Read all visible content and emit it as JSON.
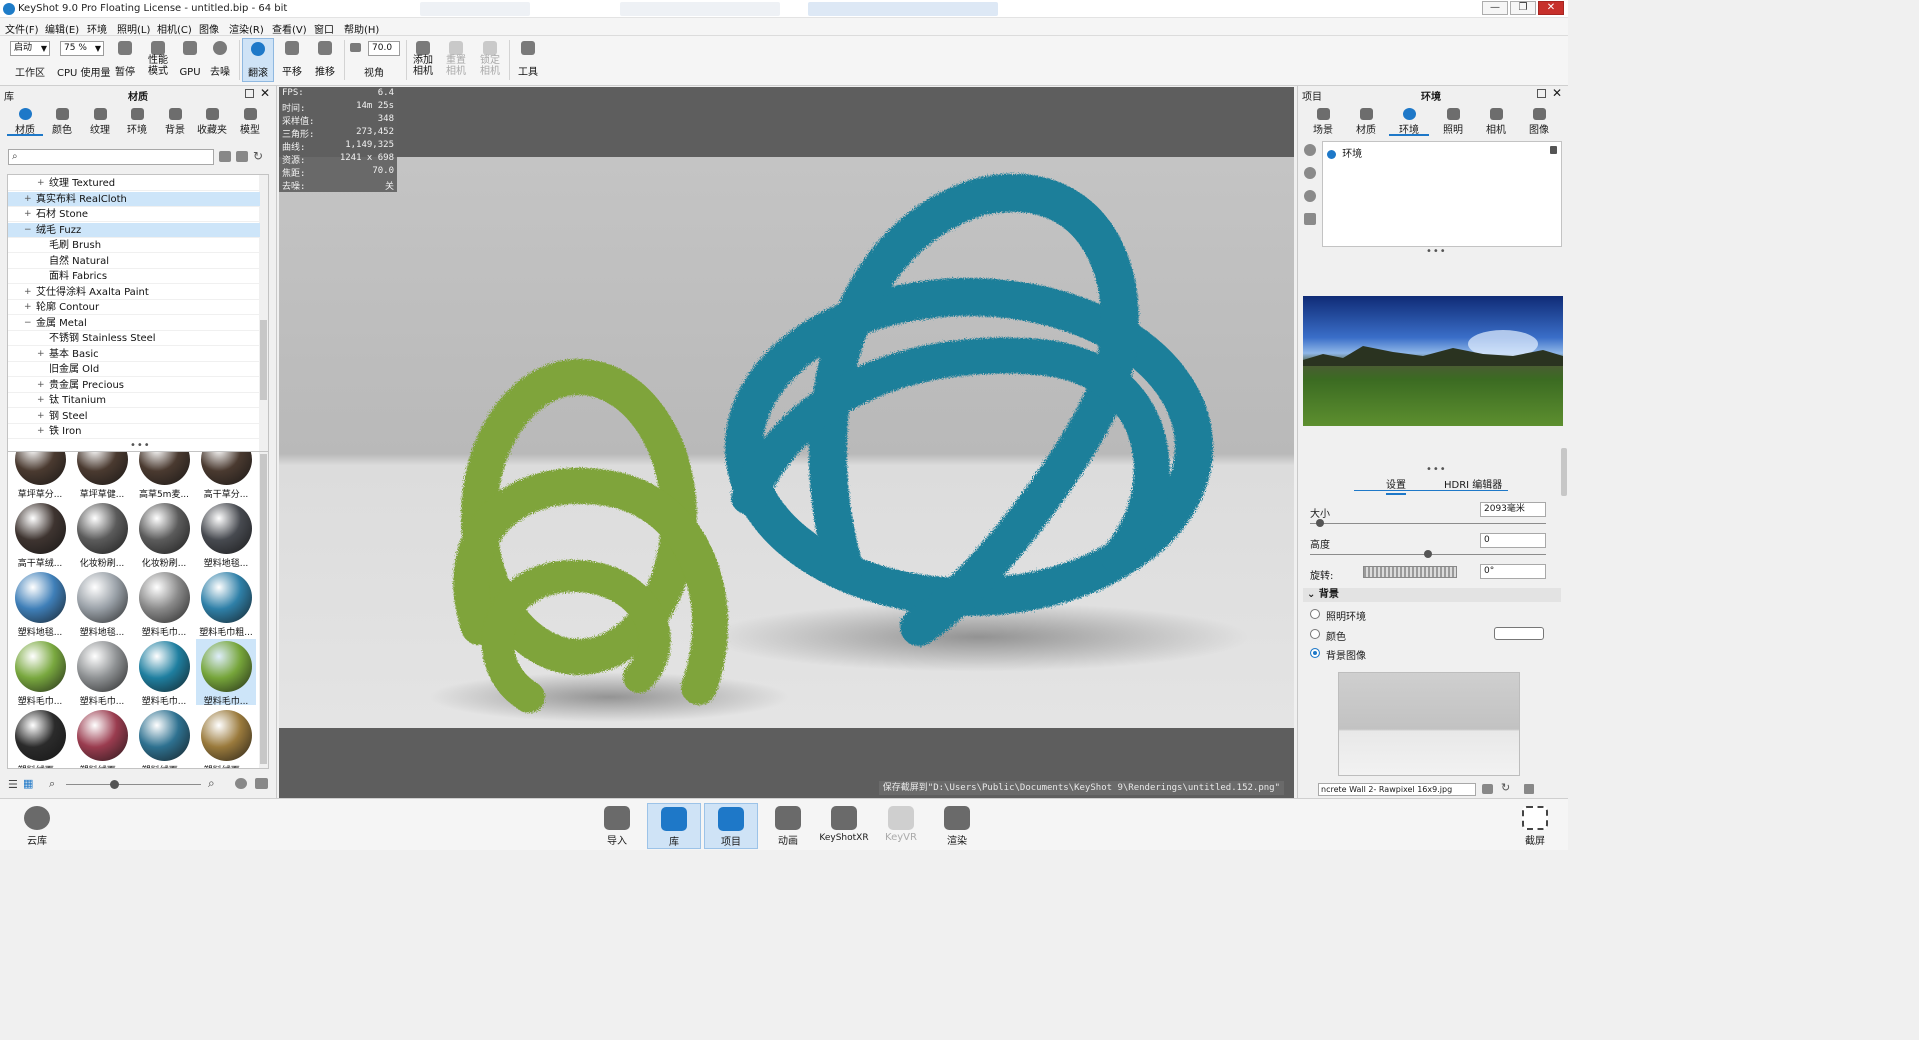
{
  "window": {
    "title": "KeyShot 9.0 Pro Floating License  - untitled.bip  - 64 bit",
    "controls": {
      "minimize": "—",
      "restore": "❐",
      "close": "✕"
    }
  },
  "menu": [
    "文件(F)",
    "编辑(E)",
    "环境",
    "照明(L)",
    "相机(C)",
    "图像",
    "渲染(R)",
    "查看(V)",
    "窗口",
    "帮助(H)"
  ],
  "toolbar": {
    "startup_value": "启动",
    "workspace_label": "工作区",
    "cpu_value": "75 %",
    "cpu_label": "CPU 使用量",
    "pause_label": "暂停",
    "performance_label": "性能\n模式",
    "gpu_label": "GPU",
    "denoise_label": "去噪",
    "tumble_label": "翻滚",
    "pan_label": "平移",
    "dolly_label": "推移",
    "fov_value": "70.0",
    "fov_label": "视角",
    "add_camera_label": "添加\n相机",
    "reset_camera_label": "重置\n相机",
    "lock_camera_label": "锁定\n相机",
    "tools_label": "工具"
  },
  "library": {
    "header_left": "库",
    "header_title": "材质",
    "tabs": [
      "材质",
      "颜色",
      "纹理",
      "环境",
      "背景",
      "收藏夹",
      "模型"
    ],
    "search_placeholder": "",
    "tree": [
      {
        "label": "纹理 Textured",
        "level": 1,
        "expander": "+",
        "selected": false
      },
      {
        "label": "真实布料 RealCloth",
        "level": 0,
        "expander": "+",
        "selected": true
      },
      {
        "label": "石材 Stone",
        "level": 0,
        "expander": "+",
        "selected": false
      },
      {
        "label": "绒毛 Fuzz",
        "level": 0,
        "expander": "−",
        "selected": true
      },
      {
        "label": "毛刷 Brush",
        "level": 1,
        "expander": "",
        "selected": false
      },
      {
        "label": "自然 Natural",
        "level": 1,
        "expander": "",
        "selected": false
      },
      {
        "label": "面料 Fabrics",
        "level": 1,
        "expander": "",
        "selected": false
      },
      {
        "label": "艾仕得涂料 Axalta Paint",
        "level": 0,
        "expander": "+",
        "selected": false
      },
      {
        "label": "轮廓 Contour",
        "level": 0,
        "expander": "+",
        "selected": false
      },
      {
        "label": "金属 Metal",
        "level": 0,
        "expander": "−",
        "selected": false
      },
      {
        "label": "不锈钢 Stainless Steel",
        "level": 1,
        "expander": "",
        "selected": false
      },
      {
        "label": "基本 Basic",
        "level": 1,
        "expander": "+",
        "selected": false
      },
      {
        "label": "旧金属 Old",
        "level": 1,
        "expander": "",
        "selected": false
      },
      {
        "label": "贵金属 Precious",
        "level": 1,
        "expander": "+",
        "selected": false
      },
      {
        "label": "钛 Titanium",
        "level": 1,
        "expander": "+",
        "selected": false
      },
      {
        "label": "钢 Steel",
        "level": 1,
        "expander": "+",
        "selected": false
      },
      {
        "label": "铁 Iron",
        "level": 1,
        "expander": "+",
        "selected": false
      }
    ],
    "materials": [
      {
        "label": "草坪草分...",
        "color": "#4a3a30",
        "selected": false
      },
      {
        "label": "草坪草健...",
        "color": "#4a3a30",
        "selected": false
      },
      {
        "label": "高草5m麦...",
        "color": "#4a3a30",
        "selected": false
      },
      {
        "label": "高干草分...",
        "color": "#4a3a30",
        "selected": false
      },
      {
        "label": "高干草绒...",
        "color": "#3e3430",
        "selected": false
      },
      {
        "label": "化妆粉刷...",
        "color": "#5b5b5b",
        "selected": false
      },
      {
        "label": "化妆粉刷...",
        "color": "#5b5b5b",
        "selected": false
      },
      {
        "label": "塑料地毯...",
        "color": "#474a50",
        "selected": false
      },
      {
        "label": "塑料地毯...",
        "color": "#3f7fb8",
        "selected": false
      },
      {
        "label": "塑料地毯...",
        "color": "#9aa1a8",
        "selected": false
      },
      {
        "label": "塑料毛巾...",
        "color": "#8a8a8a",
        "selected": false
      },
      {
        "label": "塑料毛巾粗...",
        "color": "#2f80a8",
        "selected": false
      },
      {
        "label": "塑料毛巾...",
        "color": "#79a83f",
        "selected": false
      },
      {
        "label": "塑料毛巾...",
        "color": "#8f9294",
        "selected": false
      },
      {
        "label": "塑料毛巾...",
        "color": "#1f7fa0",
        "selected": false
      },
      {
        "label": "塑料毛巾...",
        "color": "#76a53a",
        "selected": true
      },
      {
        "label": "塑料绒面...",
        "color": "#2b2b2b",
        "selected": false
      },
      {
        "label": "塑料绒面...",
        "color": "#9a3c4f",
        "selected": false
      },
      {
        "label": "塑料绒面...",
        "color": "#2e7190",
        "selected": false
      },
      {
        "label": "塑料绒面...",
        "color": "#9a7a3c",
        "selected": false
      }
    ]
  },
  "viewport": {
    "hud": [
      {
        "k": "FPS:",
        "v": "6.4"
      },
      {
        "k": "时间:",
        "v": "14m 25s"
      },
      {
        "k": "采样值:",
        "v": "348"
      },
      {
        "k": "三角形:",
        "v": "273,452"
      },
      {
        "k": "曲线:",
        "v": "1,149,325"
      },
      {
        "k": "资源:",
        "v": "1241 x 698"
      },
      {
        "k": "焦距:",
        "v": "70.0"
      },
      {
        "k": "去噪:",
        "v": "关"
      }
    ],
    "save_message": "保存截屏到\"D:\\Users\\Public\\Documents\\KeyShot 9\\Renderings\\untitled.152.png\"",
    "colors": {
      "green_knot": "#7fa43a",
      "blue_knot": "#1f7f9a"
    }
  },
  "project": {
    "header_left": "项目",
    "header_title": "环境",
    "tabs": [
      "场景",
      "材质",
      "环境",
      "照明",
      "相机",
      "图像"
    ],
    "env_item": "环境",
    "subtabs": [
      "设置",
      "HDRI 编辑器"
    ],
    "size_label": "大小",
    "size_value": "2093毫米",
    "height_label": "高度",
    "height_value": "0",
    "rotation_label": "旋转:",
    "rotation_value": "0°",
    "background_section": "背景",
    "bg_options": [
      {
        "label": "照明环境",
        "selected": false
      },
      {
        "label": "颜色",
        "selected": false
      },
      {
        "label": "背景图像",
        "selected": true
      }
    ],
    "bg_file": "ncrete Wall 2- Rawpixel 16x9.jpg"
  },
  "bottombar": {
    "cloud_label": "云库",
    "buttons": [
      {
        "label": "导入",
        "active": false,
        "disabled": false
      },
      {
        "label": "库",
        "active": true,
        "disabled": false
      },
      {
        "label": "项目",
        "active": true,
        "disabled": false
      },
      {
        "label": "动画",
        "active": false,
        "disabled": false
      },
      {
        "label": "KeyShotXR",
        "active": false,
        "disabled": false
      },
      {
        "label": "KeyVR",
        "active": false,
        "disabled": true
      },
      {
        "label": "渲染",
        "active": false,
        "disabled": false
      }
    ],
    "screenshot_label": "截屏"
  }
}
